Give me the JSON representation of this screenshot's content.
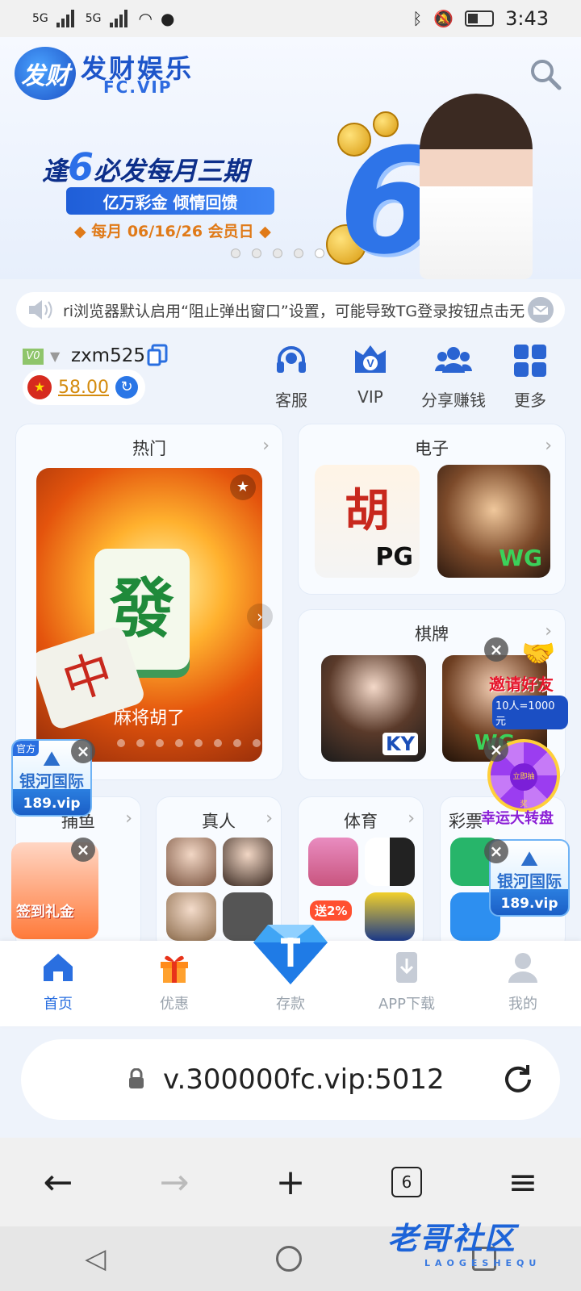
{
  "status": {
    "time": "3:43",
    "net1": "5G",
    "net2": "5G"
  },
  "brand": {
    "name": "发财娱乐",
    "domain": "FC.VIP",
    "mark": "发财"
  },
  "banner": {
    "headline_pre": "逢",
    "headline_num": "6",
    "headline_post": "必发每月三期",
    "pill": "亿万彩金 倾情回馈",
    "dates": "◆ 每月 06/16/26 会员日 ◆",
    "big_number": "6"
  },
  "notice": {
    "text": "ri浏览器默认启用“阻止弹出窗口”设置，可能导致TG登录按钮点击无"
  },
  "user": {
    "level": "V0",
    "name": "zxm525",
    "balance": "58.00"
  },
  "quick_actions": [
    {
      "label": "客服",
      "icon": "headset-icon"
    },
    {
      "label": "VIP",
      "icon": "vip-icon"
    },
    {
      "label": "分享赚钱",
      "icon": "users-icon"
    },
    {
      "label": "更多",
      "icon": "grid-icon"
    }
  ],
  "sections": {
    "hot": "热门",
    "electronic": "电子",
    "chess": "棋牌",
    "fishing": "捕鱼",
    "live": "真人",
    "sports": "体育",
    "lottery": "彩票"
  },
  "hot_game": {
    "caption": "麻将胡了",
    "tile_main": "發",
    "tile_side": "中"
  },
  "electronic_games": [
    {
      "name": "胡",
      "tag": "PG"
    },
    {
      "name": "",
      "tag": "WG"
    }
  ],
  "chess_games": [
    {
      "tag": "KY"
    },
    {
      "tag": "WG"
    }
  ],
  "promos": {
    "invite": "邀请好友",
    "invite_sub": "10人=1000元",
    "wheel": "幸运大转盘",
    "wheel_center": "立即抽奖",
    "signin": "签到礼金",
    "galaxy_title": "银河国际",
    "galaxy_domain": "189.vip",
    "galaxy_tag": "官方",
    "deposit_badge": "送2%"
  },
  "tabbar": [
    {
      "label": "首页",
      "icon": "home-icon",
      "active": true
    },
    {
      "label": "优惠",
      "icon": "gift-icon",
      "active": false
    },
    {
      "label": "存款",
      "icon": "diamond-icon",
      "active": false
    },
    {
      "label": "APP下载",
      "icon": "download-icon",
      "active": false
    },
    {
      "label": "我的",
      "icon": "person-icon",
      "active": false
    }
  ],
  "browser": {
    "url": "v.300000fc.vip:5012",
    "tab_count": "6"
  },
  "watermark": {
    "title": "老哥社区",
    "sub": "LAOGESHEQU"
  },
  "colors": {
    "accent": "#2a6fe0",
    "gold": "#d48b0e",
    "bg": "#eef3fb"
  }
}
